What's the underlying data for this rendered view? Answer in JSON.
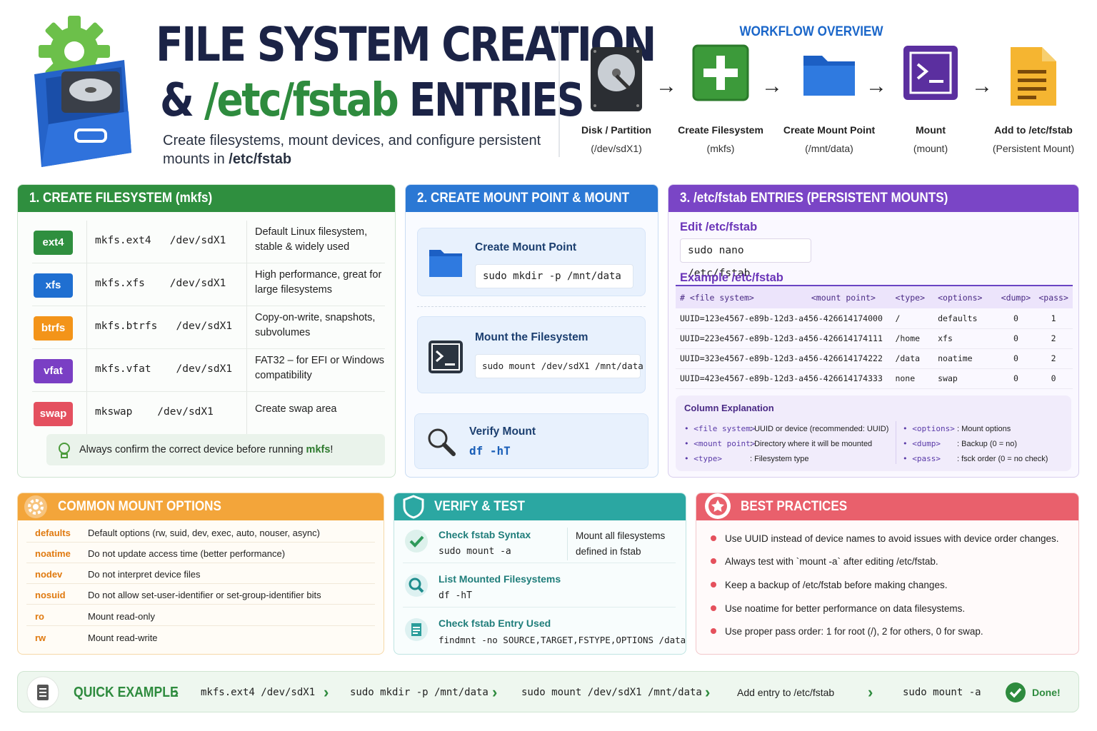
{
  "header": {
    "title_line1": "FILE SYSTEM CREATION",
    "title_line2_prefix": "& ",
    "title_line2_path": "/etc/fstab",
    "title_line2_suffix": " ENTRIES",
    "subtitle_part1": "Create filesystems, mount devices, and configure persistent mounts in ",
    "subtitle_bold": "/etc/fstab"
  },
  "workflow": {
    "title": "WORKFLOW OVERVIEW",
    "steps": [
      {
        "label": "Disk / Partition",
        "sub": "(/dev/sdX1)",
        "icon": "hard-disk-icon"
      },
      {
        "label": "Create Filesystem",
        "sub": "(mkfs)",
        "icon": "plus-icon"
      },
      {
        "label": "Create Mount Point",
        "sub": "(/mnt/data)",
        "icon": "folder-icon"
      },
      {
        "label": "Mount",
        "sub": "(mount)",
        "icon": "terminal-icon"
      },
      {
        "label": "Add to /etc/fstab",
        "sub": "(Persistent Mount)",
        "icon": "document-icon"
      }
    ],
    "arrow": "→"
  },
  "create_fs": {
    "title": "1. CREATE FILESYSTEM (mkfs)",
    "rows": [
      {
        "badge": "ext4",
        "color": "#2f8f3f",
        "cmd": "mkfs.ext4   /dev/sdX1",
        "desc": "Default Linux filesystem, stable & widely used"
      },
      {
        "badge": "xfs",
        "color": "#1f6fd1",
        "cmd": "mkfs.xfs    /dev/sdX1",
        "desc": "High performance, great for large filesystems"
      },
      {
        "badge": "btrfs",
        "color": "#f39419",
        "cmd": "mkfs.btrfs   /dev/sdX1",
        "desc": "Copy-on-write, snapshots, subvolumes"
      },
      {
        "badge": "vfat",
        "color": "#7a3fc4",
        "cmd": "mkfs.vfat    /dev/sdX1",
        "desc": "FAT32 – for EFI or Windows compatibility"
      },
      {
        "badge": "swap",
        "color": "#e4505f",
        "cmd": "mkswap    /dev/sdX1",
        "desc": "Create swap area"
      }
    ],
    "tip_prefix": "Always confirm the correct device before running ",
    "tip_bold": "mkfs",
    "tip_suffix": "!"
  },
  "mount": {
    "title": "2. CREATE MOUNT POINT & MOUNT",
    "create_title": "Create Mount Point",
    "create_cmd": "sudo mkdir -p /mnt/data",
    "mount_title": "Mount the Filesystem",
    "mount_cmd": "sudo mount /dev/sdX1 /mnt/data",
    "verify_title": "Verify Mount",
    "verify_cmd": "df -hT"
  },
  "fstab": {
    "title": "3. /etc/fstab ENTRIES (PERSISTENT MOUNTS)",
    "edit_title": "Edit /etc/fstab",
    "edit_cmd": "sudo nano /etc/fstab",
    "example_title": "Example /etc/fstab",
    "headers": [
      "# <file system>",
      "<mount point>",
      "<type>",
      "<options>",
      "<dump>",
      "<pass>"
    ],
    "rows": [
      [
        "UUID=123e4567-e89b-12d3-a456-426614174000",
        "/",
        "",
        "defaults",
        "0",
        "1"
      ],
      [
        "UUID=223e4567-e89b-12d3-a456-426614174111",
        "/home",
        "",
        "xfs",
        "0",
        "2"
      ],
      [
        "UUID=323e4567-e89b-12d3-a456-426614174222",
        "/data",
        "",
        "noatime",
        "0",
        "2"
      ],
      [
        "UUID=423e4567-e89b-12d3-a456-426614174333",
        "none",
        "",
        "swap",
        "0",
        "0"
      ]
    ],
    "explain_title": "Column Explanation",
    "explain": [
      {
        "k": "• <file system>",
        "v": ": UUID or device (recommended: UUID)"
      },
      {
        "k": "• <mount point>",
        "v": ": Directory where it will be mounted"
      },
      {
        "k": "• <type>",
        "v": ": Filesystem type"
      },
      {
        "k": "• <options>",
        "v": ": Mount options"
      },
      {
        "k": "• <dump>",
        "v": ": Backup (0 = no)"
      },
      {
        "k": "• <pass>",
        "v": ": fsck order (0 = no check)"
      }
    ]
  },
  "options": {
    "title": "COMMON MOUNT OPTIONS",
    "items": [
      {
        "k": "defaults",
        "v": "Default options (rw, suid, dev, exec, auto, nouser, async)"
      },
      {
        "k": "noatime",
        "v": "Do not update access time (better performance)"
      },
      {
        "k": "nodev",
        "v": "Do not interpret device files"
      },
      {
        "k": "nosuid",
        "v": "Do not allow set-user-identifier or set-group-identifier bits"
      },
      {
        "k": "ro",
        "v": "Mount read-only"
      },
      {
        "k": "rw",
        "v": "Mount read-write"
      }
    ]
  },
  "verify": {
    "title": "VERIFY & TEST",
    "items": [
      {
        "title": "Check fstab Syntax",
        "cmd": "sudo mount -a",
        "note": "Mount all filesystems defined in fstab"
      },
      {
        "title": "List Mounted Filesystems",
        "cmd": "df -hT"
      },
      {
        "title": "Check fstab Entry Used",
        "cmd": "findmnt -no SOURCE,TARGET,FSTYPE,OPTIONS /data"
      }
    ]
  },
  "best": {
    "title": "BEST PRACTICES",
    "items": [
      "Use UUID instead of device names to avoid issues with device order changes.",
      "Always test with `mount -a` after editing /etc/fstab.",
      "Keep a backup of /etc/fstab before making changes.",
      "Use noatime for better performance on data filesystems.",
      "Use proper pass order: 1 for root (/), 2 for others, 0 for swap."
    ]
  },
  "quick": {
    "title": "QUICK EXAMPLE",
    "steps": [
      "mkfs.ext4 /dev/sdX1",
      "sudo mkdir -p /mnt/data",
      "sudo mount /dev/sdX1 /mnt/data",
      "Add entry to /etc/fstab",
      "sudo mount -a"
    ],
    "done": "Done!",
    "chevron": "›"
  }
}
